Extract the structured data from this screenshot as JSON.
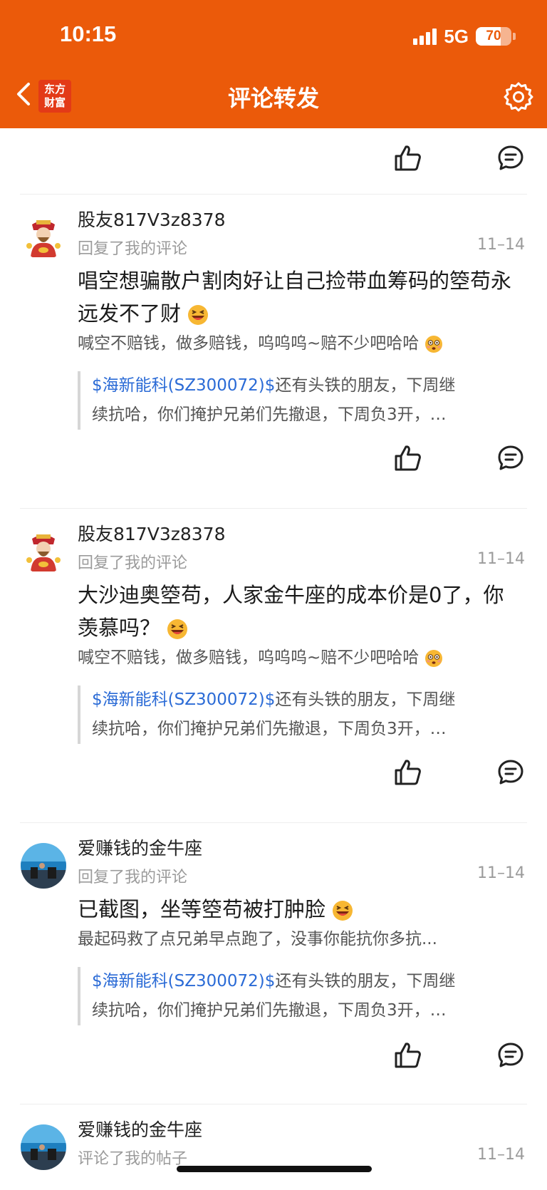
{
  "status": {
    "time": "10:15",
    "network": "5G",
    "battery": "70",
    "battery_level": 0.7
  },
  "header": {
    "title": "评论转发",
    "logo_line1": "东方",
    "logo_line2": "财富"
  },
  "colors": {
    "brand": "#EB5A0A",
    "stock_link": "#2B6BD6",
    "muted": "#9B9B9B"
  },
  "comments": [
    {
      "user": "股友817V3z8378",
      "action": "回复了我的评论",
      "date": "11–14",
      "content": "唱空想骗散户割肉好让自己捡带血筹码的箜苟永远发不了财",
      "content_emoji": "grinning-squint-emoji",
      "my_comment": "喊空不赔钱，做多赔钱，呜呜呜~赔不少吧哈哈",
      "my_comment_emoji": "flushed-emoji",
      "quote_stock": "$海新能科(SZ300072)$",
      "quote_rest": "还有头铁的朋友，下周继",
      "quote_line2": "续抗哈，你们掩护兄弟们先撤退，下周负3开，…"
    },
    {
      "user": "股友817V3z8378",
      "action": "回复了我的评论",
      "date": "11–14",
      "content": "大沙迪奥箜苟，人家金牛座的成本价是0了，你羡慕吗？",
      "content_emoji": "grinning-squint-emoji",
      "my_comment": "喊空不赔钱，做多赔钱，呜呜呜~赔不少吧哈哈",
      "my_comment_emoji": "flushed-emoji",
      "quote_stock": "$海新能科(SZ300072)$",
      "quote_rest": "还有头铁的朋友，下周继",
      "quote_line2": "续抗哈，你们掩护兄弟们先撤退，下周负3开，…"
    },
    {
      "user": "爱赚钱的金牛座",
      "action": "回复了我的评论",
      "date": "11–14",
      "content": "已截图，坐等箜苟被打肿脸",
      "content_emoji": "grinning-squint-emoji",
      "my_comment": "最起码救了点兄弟早点跑了，没事你能抗你多抗...",
      "quote_stock": "$海新能科(SZ300072)$",
      "quote_rest": "还有头铁的朋友，下周继",
      "quote_line2": "续抗哈，你们掩护兄弟们先撤退，下周负3开，…"
    },
    {
      "user": "爱赚钱的金牛座",
      "action": "评论了我的帖子",
      "date": "11–14"
    }
  ]
}
